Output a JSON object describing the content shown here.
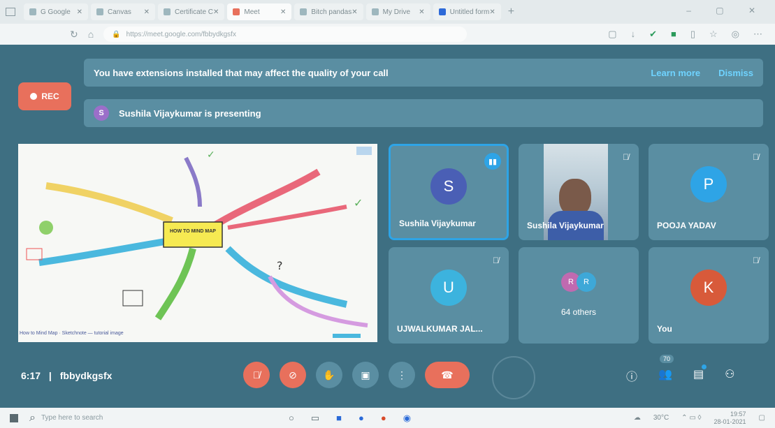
{
  "browser": {
    "tabs": [
      {
        "label": "G Google"
      },
      {
        "label": "Canvas"
      },
      {
        "label": "Certificate C"
      },
      {
        "label": "Meet"
      },
      {
        "label": "Bitch pandas"
      },
      {
        "label": "My Drive"
      },
      {
        "label": "Untitled form"
      }
    ],
    "new_tab_symbol": "+",
    "url": "https://meet.google.com/fbbydkgsfx",
    "window_controls": "– ▢ ✕"
  },
  "meet": {
    "rec_label": "REC",
    "banner": {
      "text": "You have extensions installed that may affect the quality of your call",
      "learn_more": "Learn more",
      "dismiss": "Dismiss"
    },
    "presenting": {
      "initial": "S",
      "text": "Sushila Vijaykumar is presenting"
    },
    "screen_caption": "How to Mind Map · Sketchnote — tutorial image",
    "screen_title": "HOW TO MIND MAP",
    "tiles": [
      {
        "name": "Sushila Vijaykumar",
        "initial": "S",
        "color": "#4a5fb5",
        "speaking": true
      },
      {
        "name": "Sushila Vijaykumar",
        "video": true
      },
      {
        "name": "POOJA YADAV",
        "initial": "P",
        "color": "#2ea4e6"
      },
      {
        "name": "UJWALKUMAR JAL...",
        "initial": "U",
        "color": "#3cb3de"
      },
      {
        "others_label": "64 others",
        "initial_a": "R",
        "initial_b": "R",
        "color_a": "#c06ab0",
        "color_b": "#3ea8d8"
      },
      {
        "name": "You",
        "initial": "K",
        "color": "#d85a3a"
      }
    ],
    "meeting_time": "6:17",
    "meeting_code": "fbbydkgsfx",
    "participant_count": "70"
  },
  "taskbar": {
    "search_placeholder": "Type here to search",
    "temperature": "30°C",
    "time": "19:57",
    "date": "28-01-2021"
  }
}
